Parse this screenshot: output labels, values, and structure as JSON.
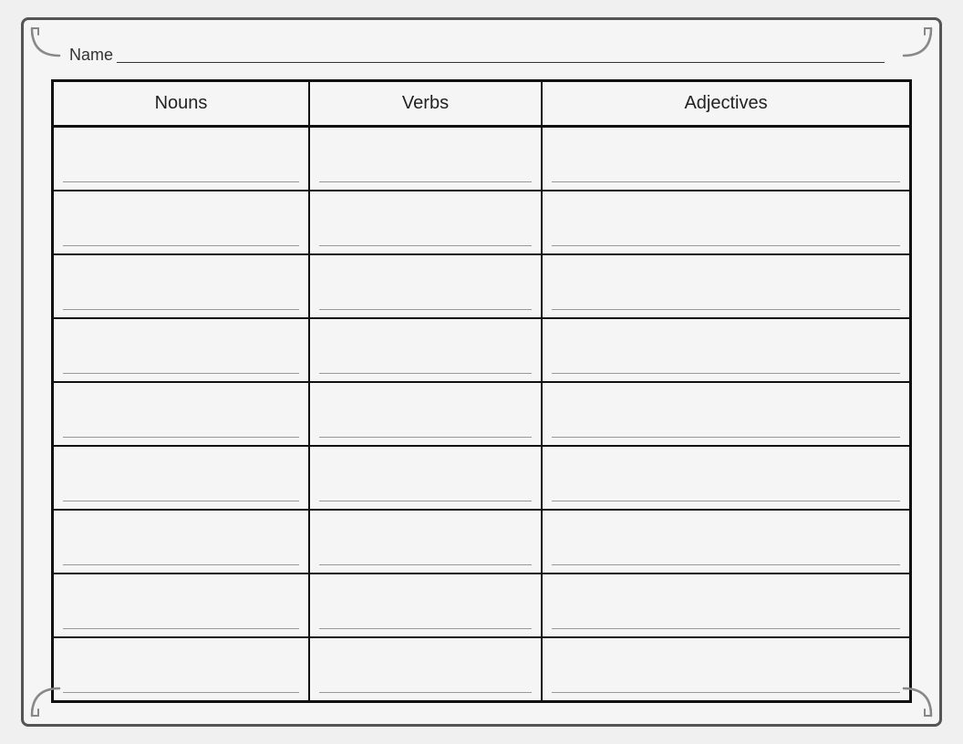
{
  "page": {
    "name_label": "Name",
    "name_underline": "",
    "columns": [
      {
        "id": "nouns",
        "label": "Nouns"
      },
      {
        "id": "verbs",
        "label": "Verbs"
      },
      {
        "id": "adjectives",
        "label": "Adjectives"
      }
    ],
    "row_count": 9
  }
}
